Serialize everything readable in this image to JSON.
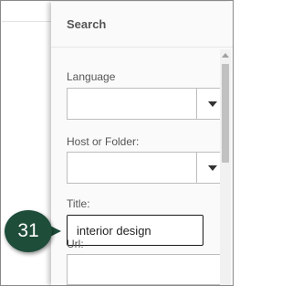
{
  "search_panel": {
    "title": "Search",
    "language": {
      "label": "Language",
      "value": ""
    },
    "host_or_folder": {
      "label": "Host or Folder:",
      "value": ""
    },
    "title_field": {
      "label": "Title:",
      "value": "interior design"
    },
    "url_field": {
      "label": "Url:",
      "value": ""
    }
  },
  "step_badge": {
    "number": "31",
    "color": "#1e4d3a"
  },
  "icons": {
    "dropdown": "caret-down-icon",
    "scroll_up": "scroll-up-arrow-icon"
  }
}
